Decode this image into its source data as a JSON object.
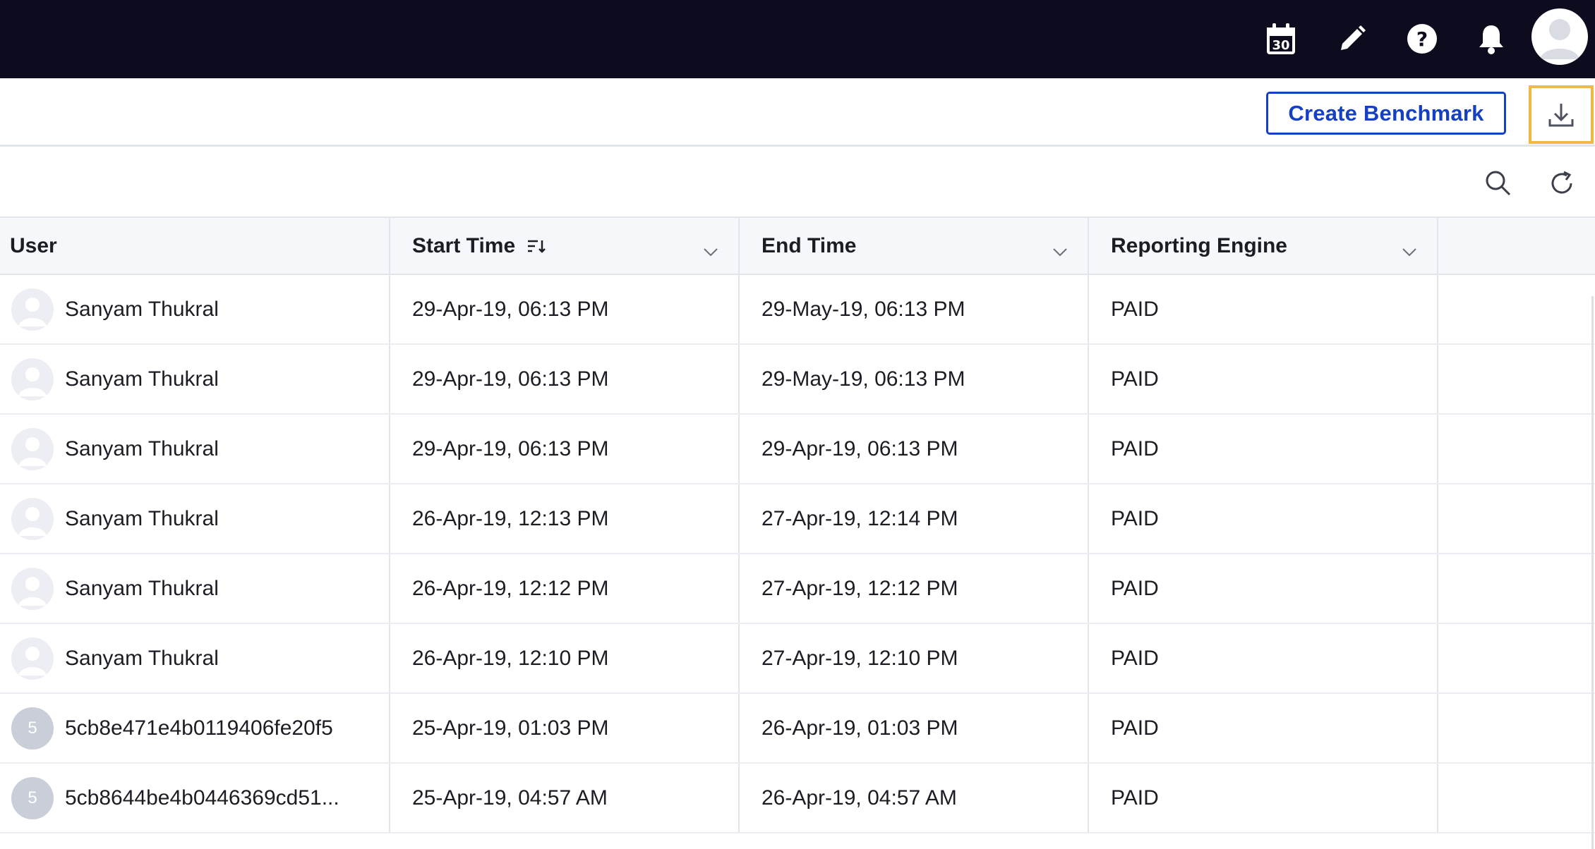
{
  "topbar": {
    "icons": [
      "calendar-icon",
      "edit-pencil-icon",
      "help-icon",
      "notification-bell-icon",
      "user-avatar"
    ],
    "calendar_day": "30"
  },
  "actions": {
    "create_benchmark_label": "Create Benchmark",
    "download_icon": "download-icon",
    "download_highlight_color": "#f0b947"
  },
  "toolstrip": {
    "icons": [
      "search-icon",
      "refresh-icon"
    ]
  },
  "table": {
    "columns": [
      {
        "label": "User",
        "filter": false,
        "sort": false
      },
      {
        "label": "Start Time",
        "filter": true,
        "sort": true
      },
      {
        "label": "End Time",
        "filter": true,
        "sort": false
      },
      {
        "label": "Reporting Engine",
        "filter": true,
        "sort": false
      },
      {
        "label": "",
        "filter": false,
        "sort": false
      }
    ],
    "rows": [
      {
        "user": "Sanyam Thukral",
        "avatar": "photo",
        "start": "29-Apr-19, 06:13 PM",
        "end": "29-May-19, 06:13 PM",
        "engine": "PAID"
      },
      {
        "user": "Sanyam Thukral",
        "avatar": "photo",
        "start": "29-Apr-19, 06:13 PM",
        "end": "29-May-19, 06:13 PM",
        "engine": "PAID"
      },
      {
        "user": "Sanyam Thukral",
        "avatar": "photo",
        "start": "29-Apr-19, 06:13 PM",
        "end": "29-Apr-19, 06:13 PM",
        "engine": "PAID"
      },
      {
        "user": "Sanyam Thukral",
        "avatar": "photo",
        "start": "26-Apr-19, 12:13 PM",
        "end": "27-Apr-19, 12:14 PM",
        "engine": "PAID"
      },
      {
        "user": "Sanyam Thukral",
        "avatar": "photo",
        "start": "26-Apr-19, 12:12 PM",
        "end": "27-Apr-19, 12:12 PM",
        "engine": "PAID"
      },
      {
        "user": "Sanyam Thukral",
        "avatar": "photo",
        "start": "26-Apr-19, 12:10 PM",
        "end": "27-Apr-19, 12:10 PM",
        "engine": "PAID"
      },
      {
        "user": "5cb8e471e4b0119406fe20f5",
        "avatar": "initial",
        "initial": "5",
        "start": "25-Apr-19, 01:03 PM",
        "end": "26-Apr-19, 01:03 PM",
        "engine": "PAID"
      },
      {
        "user": "5cb8644be4b0446369cd51...",
        "avatar": "initial",
        "initial": "5",
        "start": "25-Apr-19, 04:57 AM",
        "end": "26-Apr-19, 04:57 AM",
        "engine": "PAID"
      }
    ]
  },
  "colors": {
    "topbar_bg": "#0c0c1e",
    "accent_blue": "#1540c3",
    "header_bg": "#f6f7fb"
  }
}
